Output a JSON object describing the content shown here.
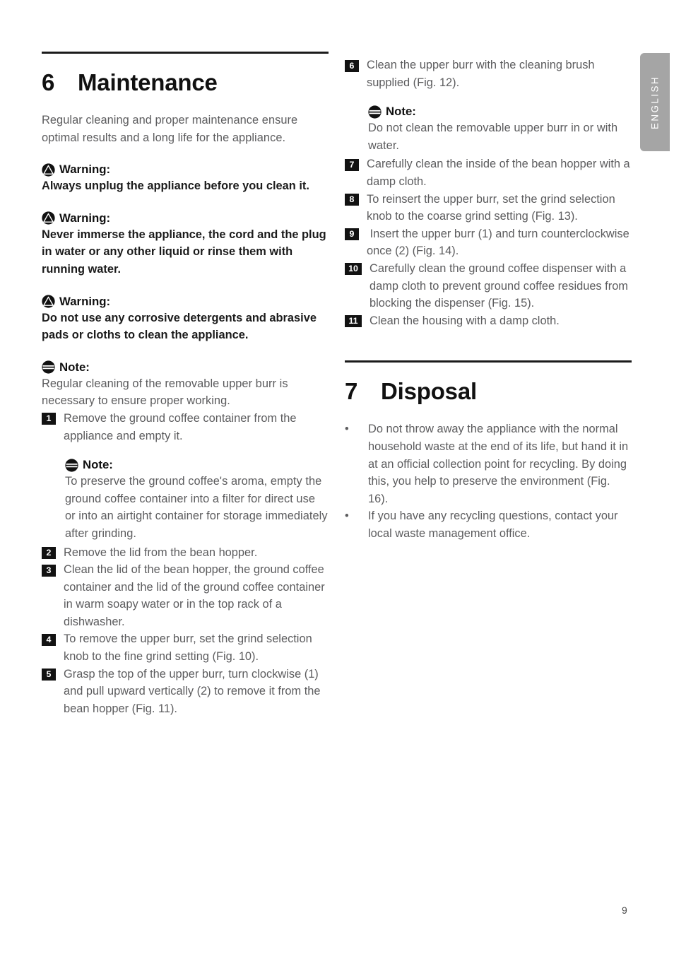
{
  "language_tab": {
    "label": "ENGLISH"
  },
  "page_number": "9",
  "icons": {
    "warning": "warning-triangle-icon",
    "note": "note-icon"
  },
  "sections": {
    "maintenance": {
      "number": "6",
      "title": "Maintenance",
      "intro": "Regular cleaning and proper maintenance ensure optimal results and a long life for the appliance.",
      "callouts": [
        {
          "type": "warning",
          "label": "Warning:",
          "text": "Always unplug the appliance before you clean it."
        },
        {
          "type": "warning",
          "label": "Warning:",
          "text": "Never immerse the appliance, the cord and the plug in water or any other liquid or rinse them with running water."
        },
        {
          "type": "warning",
          "label": "Warning:",
          "text": "Do not use any corrosive detergents and abrasive pads or cloths to clean the appliance."
        },
        {
          "type": "note",
          "label": "Note:",
          "text": "Regular cleaning of the removable upper burr is necessary to ensure proper working."
        }
      ],
      "inline_note": {
        "type": "note",
        "label": "Note:",
        "text": "To preserve the ground coffee's aroma, empty the ground coffee container into a filter for direct use or into an airtight container for storage immediately after grinding."
      },
      "right_note": {
        "type": "note",
        "label": "Note:",
        "text": "Do not clean the removable upper burr in or with water."
      },
      "steps_left": [
        {
          "num": "1",
          "text": "Remove the ground coffee container from the appliance and empty it."
        },
        {
          "num": "2",
          "text": "Remove the lid from the bean hopper."
        },
        {
          "num": "3",
          "text": "Clean the lid of the bean hopper, the ground coffee container and the lid of the ground coffee container in warm soapy water or in the top rack of a dishwasher."
        },
        {
          "num": "4",
          "text": "To remove the upper burr, set the grind selection knob to the fine grind setting (Fig. 10)."
        },
        {
          "num": "5",
          "text": "Grasp the top of the upper burr, turn clockwise (1) and pull upward vertically (2) to remove it from the bean hopper (Fig. 11)."
        }
      ],
      "steps_right_before_note": [
        {
          "num": "6",
          "text": "Clean the upper burr with the cleaning brush supplied (Fig. 12)."
        }
      ],
      "steps_right_after_note": [
        {
          "num": "7",
          "text": "Carefully clean the inside of the bean hopper with a damp cloth."
        },
        {
          "num": "8",
          "text": "To reinsert the upper burr, set the grind selection knob to the coarse grind setting (Fig. 13)."
        },
        {
          "num": "9",
          "text": " Insert the upper burr (1) and turn counterclockwise once (2) (Fig. 14)."
        },
        {
          "num": "10",
          "text": "Carefully clean the ground coffee dispenser with a damp cloth to prevent ground coffee residues from blocking the dispenser (Fig. 15)."
        },
        {
          "num": "11",
          "text": "Clean the housing with a damp cloth."
        }
      ]
    },
    "disposal": {
      "number": "7",
      "title": "Disposal",
      "bullet_marker": "•",
      "bullets": [
        "Do not throw away the appliance with the normal household waste at the end of its life, but hand it in at an official collection point for recycling. By doing this, you help to preserve the environment (Fig. 16).",
        "If you have any recycling questions, contact your local waste management office."
      ]
    }
  }
}
